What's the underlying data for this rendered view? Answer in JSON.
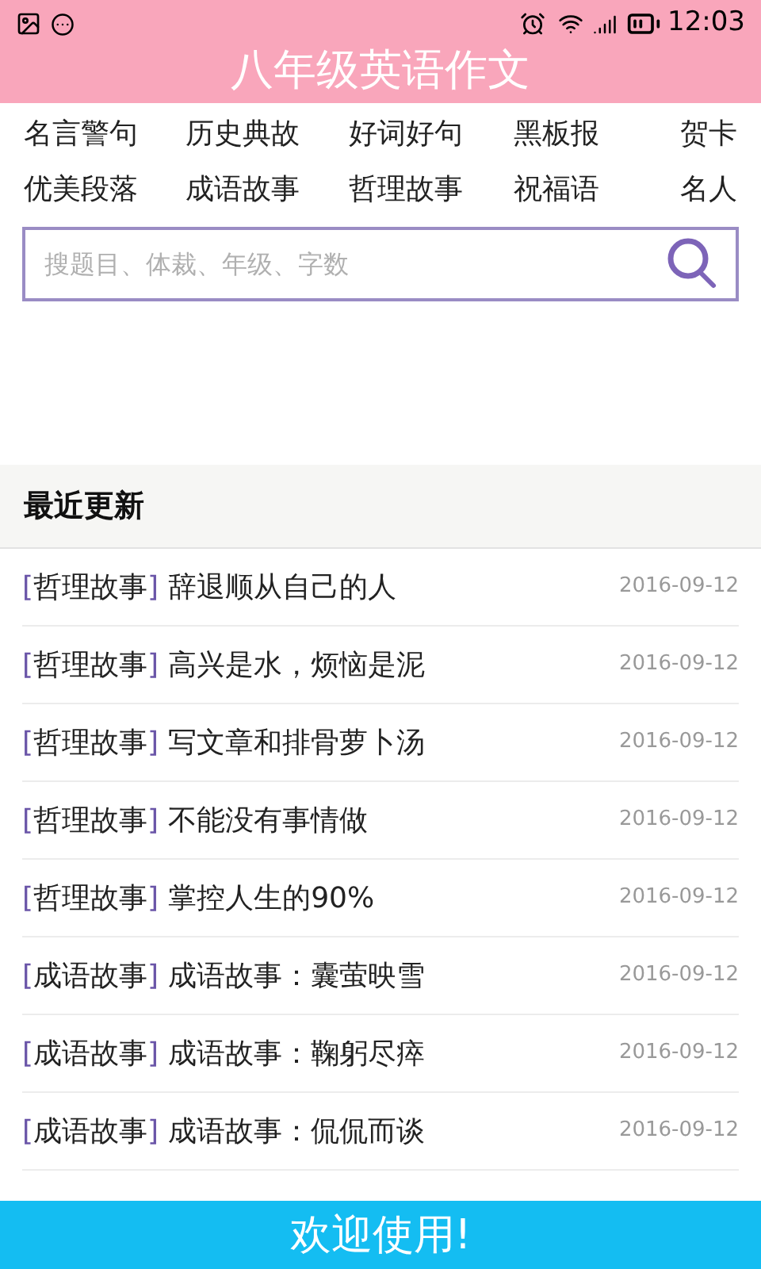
{
  "status_bar": {
    "time": "12:03"
  },
  "header": {
    "title": "八年级英语作文"
  },
  "categories": [
    [
      "名言警句",
      "历史典故",
      "好词好句",
      "黑板报",
      "贺卡"
    ],
    [
      "优美段落",
      "成语故事",
      "哲理故事",
      "祝福语",
      "名人"
    ]
  ],
  "search": {
    "placeholder": "搜题目、体裁、年级、字数"
  },
  "section": {
    "title": "最近更新"
  },
  "articles": [
    {
      "tag": "[哲理故事]",
      "title": "辞退顺从自己的人",
      "date": "2016-09-12"
    },
    {
      "tag": "[哲理故事]",
      "title": "高兴是水，烦恼是泥",
      "date": "2016-09-12"
    },
    {
      "tag": "[哲理故事]",
      "title": "写文章和排骨萝卜汤",
      "date": "2016-09-12"
    },
    {
      "tag": "[哲理故事]",
      "title": "不能没有事情做",
      "date": "2016-09-12"
    },
    {
      "tag": "[哲理故事]",
      "title": "掌控人生的90%",
      "date": "2016-09-12"
    },
    {
      "tag": "[成语故事]",
      "title": "成语故事：囊萤映雪",
      "date": "2016-09-12"
    },
    {
      "tag": "[成语故事]",
      "title": "成语故事：鞠躬尽瘁",
      "date": "2016-09-12"
    },
    {
      "tag": "[成语故事]",
      "title": "成语故事：侃侃而谈",
      "date": "2016-09-12"
    }
  ],
  "banner": {
    "text": "欢迎使用!"
  }
}
